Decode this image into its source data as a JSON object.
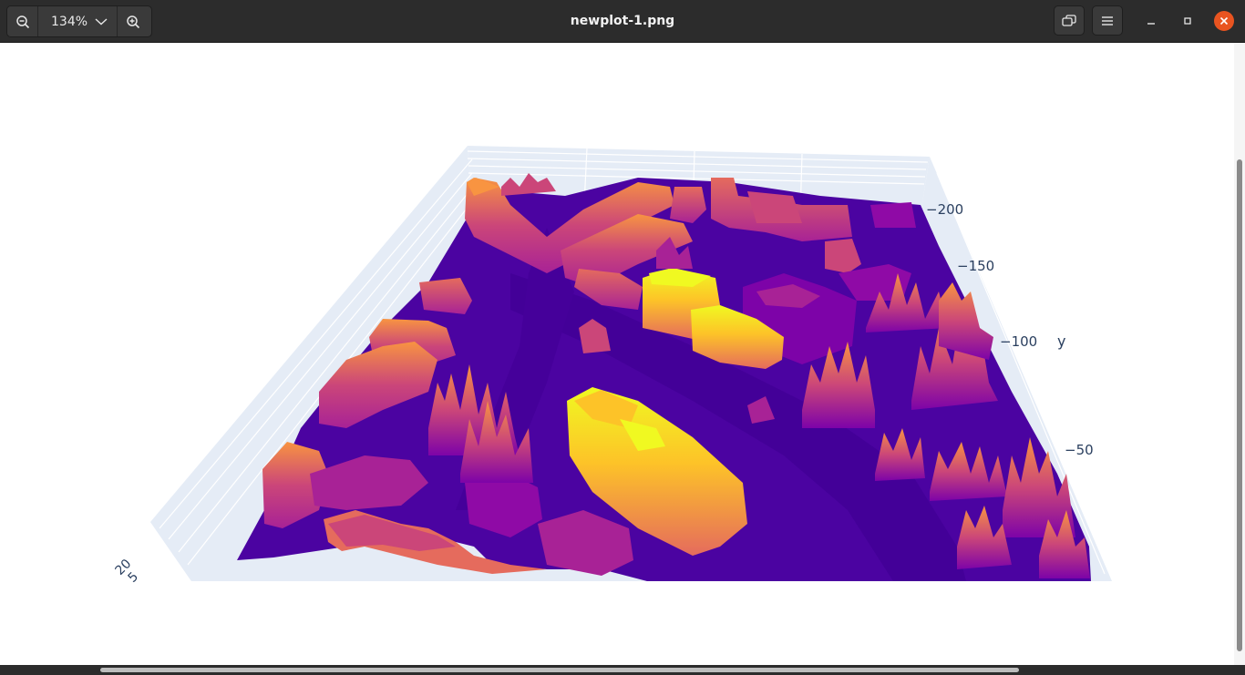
{
  "window": {
    "title": "newplot-1.png",
    "zoom_level": "134%"
  },
  "toolbar": {
    "zoom_out_icon": "zoom-out-icon",
    "zoom_in_icon": "zoom-in-icon",
    "zoom_dropdown_icon": "chevron-down-icon",
    "view_mode_icon": "window-mode-icon",
    "menu_icon": "hamburger-menu-icon",
    "minimize_icon": "minimize-icon",
    "maximize_icon": "maximize-icon",
    "close_icon": "close-icon",
    "close_color": "#e95420"
  },
  "image": {
    "plot": {
      "axis_y_title": "y",
      "y_ticks": [
        "−200",
        "−150",
        "−100",
        "−50"
      ],
      "x_ticks": [
        "20",
        "5"
      ],
      "colorscale": [
        "#4b03a1",
        "#7d03a8",
        "#a82296",
        "#cb4679",
        "#e56b5d",
        "#f89441",
        "#fdc328",
        "#f0f921"
      ]
    }
  }
}
